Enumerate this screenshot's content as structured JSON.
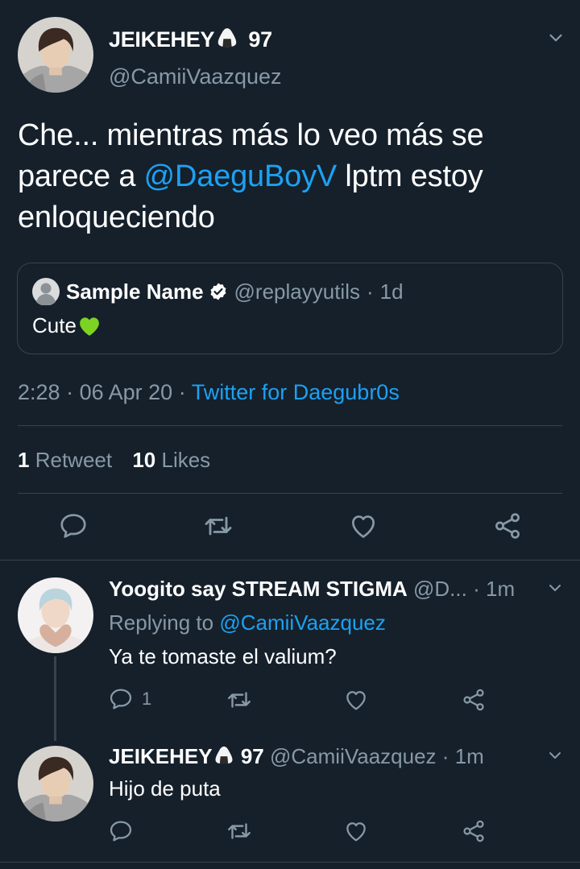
{
  "main_tweet": {
    "display_name": "JEIKEHEY",
    "display_name_suffix": "97",
    "handle": "@CamiiVaazquez",
    "text_before_mention": "Che... mientras más lo veo más se parece a ",
    "mention": "@DaeguBoyV",
    "text_after_mention": " lptm estoy enloqueciendo",
    "quoted": {
      "name": "Sample Name",
      "handle": "@replayyutils",
      "separator": "·",
      "time": "1d",
      "text": "Cute"
    },
    "time": "2:28",
    "date": "06 Apr 20",
    "separator": "·",
    "source": "Twitter for Daegubr0s",
    "retweets_count": "1",
    "retweets_label": "Retweet",
    "likes_count": "10",
    "likes_label": "Likes"
  },
  "replies": [
    {
      "display_name": "Yoogito say STREAM STIGMA",
      "handle": "@D...",
      "separator": "·",
      "time": "1m",
      "replying_to_label": "Replying to ",
      "replying_to_handle": "@CamiiVaazquez",
      "text": "Ya te tomaste el valium?",
      "reply_count": "1"
    },
    {
      "display_name": "JEIKEHEY",
      "display_name_suffix": "97",
      "handle": "@CamiiVaazquez",
      "separator": "·",
      "time": "1m",
      "text": "Hijo de puta"
    }
  ],
  "colors": {
    "background": "#15202b",
    "link": "#1da1f2",
    "muted": "#8899a6",
    "border": "#38444d",
    "heart_emoji": "#7cd321"
  },
  "icons": [
    "chevron-down-icon",
    "verified-badge-icon",
    "reply-icon",
    "retweet-icon",
    "like-icon",
    "share-icon",
    "rice-ball-emoji",
    "green-heart-emoji",
    "default-avatar-icon"
  ]
}
